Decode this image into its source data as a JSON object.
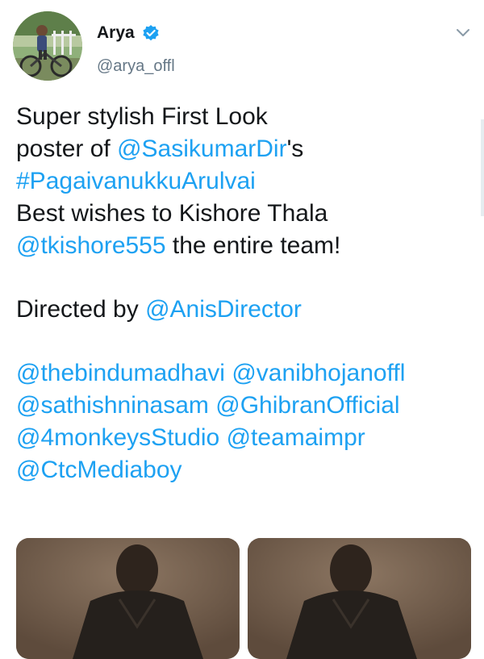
{
  "tweet": {
    "author": {
      "display_name": "Arya",
      "handle": "@arya_offl",
      "verified": true,
      "avatar_icon": "avatar-photo"
    },
    "menu_icon": "chevron-down-icon",
    "text_lines": [
      [
        {
          "t": "Super stylish First Look"
        }
      ],
      [
        {
          "t": "poster of "
        },
        {
          "t": "@SasikumarDir",
          "link": true
        },
        {
          "t": "'s"
        }
      ],
      [
        {
          "t": "#PagaivanukkuArulvai",
          "link": true
        }
      ],
      [
        {
          "t": "Best wishes to Kishore Thala"
        }
      ],
      [
        {
          "t": "@tkishore555",
          "link": true
        },
        {
          "t": " the entire team!"
        }
      ],
      [],
      [
        {
          "t": "Directed by "
        },
        {
          "t": "@AnisDirector",
          "link": true
        }
      ],
      [],
      [
        {
          "t": "@thebindumadhavi",
          "link": true
        },
        {
          "t": " "
        },
        {
          "t": "@vanibhojanoffl",
          "link": true
        }
      ],
      [
        {
          "t": "@sathishninasam",
          "link": true
        },
        {
          "t": " "
        },
        {
          "t": "@GhibranOfficial",
          "link": true
        }
      ],
      [
        {
          "t": "@4monkeysStudio",
          "link": true
        },
        {
          "t": " "
        },
        {
          "t": "@teamaimpr",
          "link": true
        }
      ],
      [
        {
          "t": "@CtcMediaboy",
          "link": true
        }
      ]
    ],
    "media": [
      {
        "name": "media-image-1",
        "icon": "poster-image"
      },
      {
        "name": "media-image-2",
        "icon": "poster-image"
      }
    ]
  },
  "colors": {
    "text": "#14171a",
    "link": "#1da1f2",
    "secondary": "#657786",
    "verified": "#1da1f2"
  }
}
